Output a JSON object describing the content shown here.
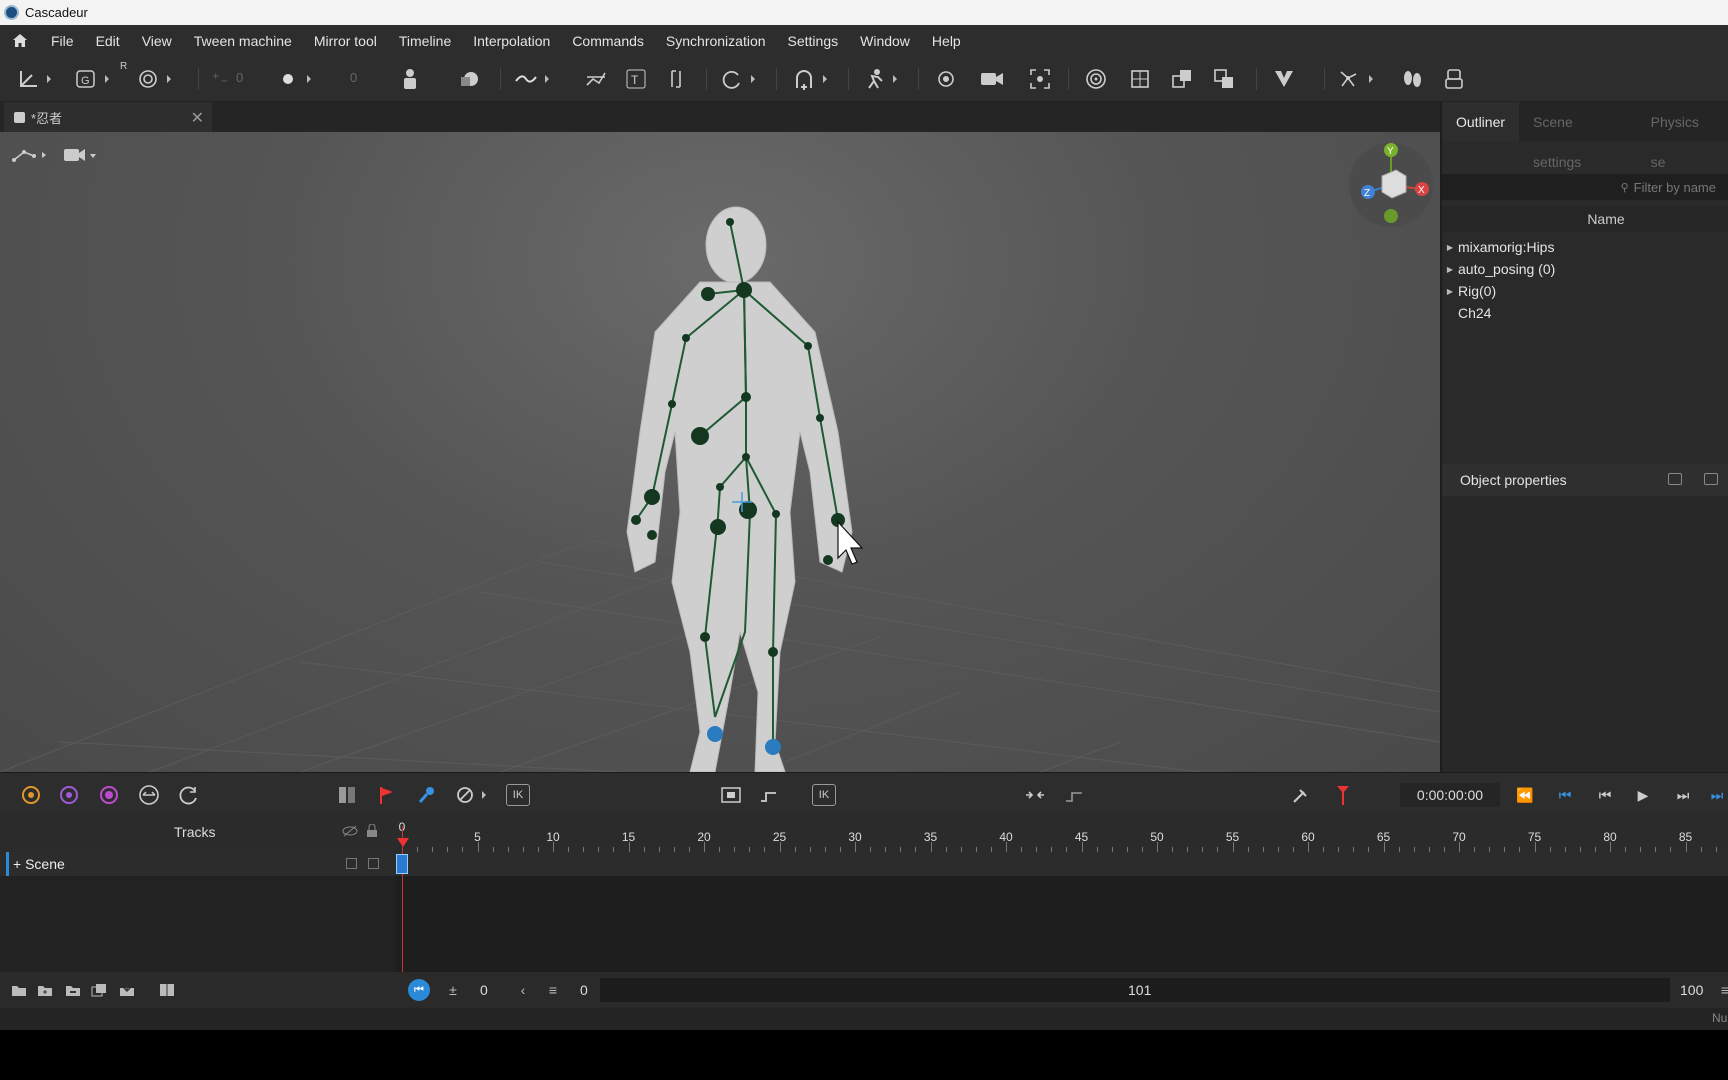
{
  "app": {
    "title": "Cascadeur"
  },
  "menu": [
    "File",
    "Edit",
    "View",
    "Tween machine",
    "Mirror tool",
    "Timeline",
    "Interpolation",
    "Commands",
    "Synchronization",
    "Settings",
    "Window",
    "Help"
  ],
  "toolbar": {
    "field1_value": "0",
    "field2_value": "0",
    "r_label": "R"
  },
  "tabs": [
    {
      "label": "*忍者"
    }
  ],
  "viewport": {
    "axes": {
      "y": "Y",
      "x": "X",
      "z": "Z"
    }
  },
  "right_panel": {
    "tabs": [
      "Outliner",
      "Scene settings",
      "Physics se"
    ],
    "filter_placeholder": "Filter by name",
    "name_header": "Name",
    "items": [
      {
        "label": "mixamorig:Hips",
        "expandable": true
      },
      {
        "label": "auto_posing (0)",
        "expandable": true
      },
      {
        "label": "Rig(0)",
        "expandable": true
      },
      {
        "label": "Ch24",
        "expandable": false
      }
    ],
    "object_properties": "Object properties"
  },
  "anim_toolbar": {
    "timecode": "0:00:00:00",
    "ik1": "IK",
    "ik2": "IK",
    "ik3": "IK"
  },
  "tracks": {
    "header": "Tracks",
    "scene_label": "+ Scene",
    "ruler_labels": [
      "0",
      "5",
      "10",
      "15",
      "20",
      "25",
      "30",
      "35",
      "40",
      "45",
      "50",
      "55",
      "60",
      "65",
      "70",
      "75",
      "80",
      "85"
    ]
  },
  "bottom": {
    "frame_value": "0",
    "start_value": "0",
    "range_mid": "101",
    "end_value": "100",
    "status_text": "Nu"
  },
  "colors": {
    "accent": "#2a8ad8",
    "bone": "#1b4a2a",
    "playhead": "#e33333"
  }
}
